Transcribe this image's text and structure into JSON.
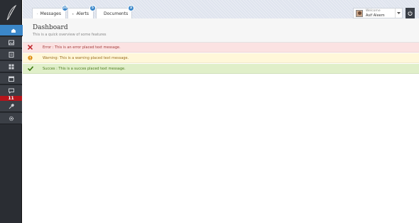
{
  "sidebar": {
    "items": [
      {
        "icon": "home-icon"
      },
      {
        "icon": "image-icon"
      },
      {
        "icon": "document-icon"
      },
      {
        "icon": "grid-icon"
      },
      {
        "icon": "calendar-icon"
      },
      {
        "icon": "chat-icon",
        "badge": "11"
      },
      {
        "icon": "tools-icon"
      },
      {
        "icon": "gear-icon"
      }
    ]
  },
  "header": {
    "tabs": [
      {
        "label": "Messages",
        "badge": "20",
        "icon": "mail-icon"
      },
      {
        "label": "Alerts",
        "badge": "5",
        "icon": "alert-icon"
      },
      {
        "label": "Documents",
        "badge": "3",
        "icon": "file-icon"
      }
    ],
    "user": {
      "welcome": "Welcome",
      "name": "Asif Aleem"
    }
  },
  "page": {
    "title": "Dashboard",
    "subtitle": "This is a quick overview of some features"
  },
  "alerts": [
    {
      "type": "error",
      "text": "Error : This is an error placed text message."
    },
    {
      "type": "warning",
      "text": "Warning: This is a warning placed text message."
    },
    {
      "type": "success",
      "text": "Succes : This is a succes placed text message."
    }
  ],
  "colors": {
    "accent": "#3b87c9",
    "sidebar": "#2a2d33",
    "error_bg": "#fbe2e2",
    "warning_bg": "#fff7d9",
    "success_bg": "#e0efc9",
    "badge_red": "#b5151b"
  }
}
